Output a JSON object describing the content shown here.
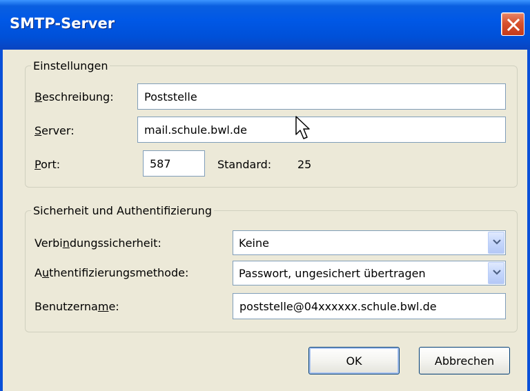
{
  "window": {
    "title": "SMTP-Server"
  },
  "settings": {
    "legend": "Einstellungen",
    "description_label_u": "B",
    "description_label_rest": "eschreibung:",
    "description_value": "Poststelle",
    "server_label_u": "S",
    "server_label_rest": "erver:",
    "server_value": "mail.schule.bwl.de",
    "port_label_u": "P",
    "port_label_rest": "ort:",
    "port_value": "587",
    "default_label": "Standard:",
    "default_value": "25"
  },
  "security": {
    "legend": "Sicherheit und Authentifizierung",
    "connection_label_pre": "Verbi",
    "connection_label_u": "n",
    "connection_label_post": "dungssicherheit:",
    "connection_value": "Keine",
    "auth_label_pre": "A",
    "auth_label_u": "u",
    "auth_label_post": "thentifizierungsmethode:",
    "auth_value": "Passwort, ungesichert übertragen",
    "user_label_pre": "Benutzerna",
    "user_label_u": "m",
    "user_label_post": "e:",
    "user_value": "poststelle@04xxxxxx.schule.bwl.de"
  },
  "buttons": {
    "ok": "OK",
    "cancel": "Abbrechen"
  },
  "icons": [
    "close-icon",
    "chevron-down-icon",
    "mouse-cursor-icon"
  ],
  "colors": {
    "titlebar": "#0058e6",
    "dialog_bg": "#ece9d8",
    "close": "#d8522f"
  }
}
